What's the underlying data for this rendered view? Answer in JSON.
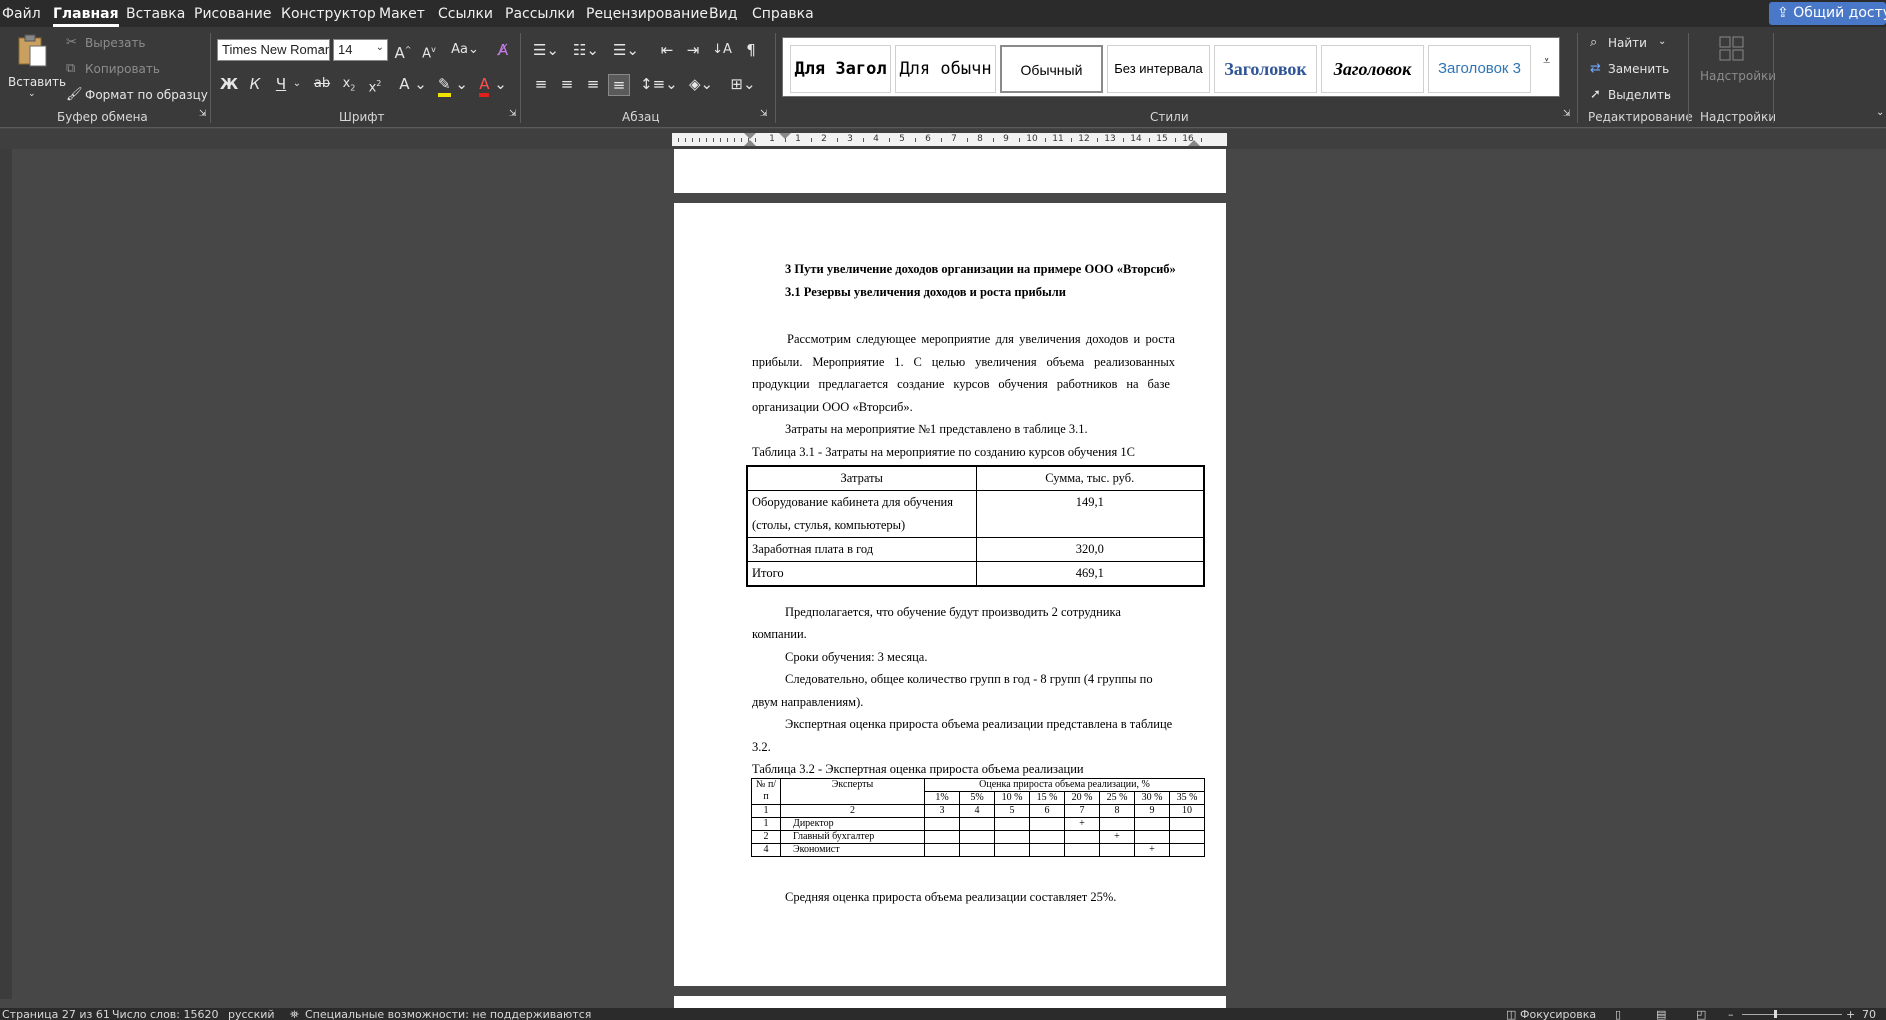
{
  "menu": {
    "items": [
      "Файл",
      "Главная",
      "Вставка",
      "Рисование",
      "Конструктор",
      "Макет",
      "Ссылки",
      "Рассылки",
      "Рецензирование",
      "Вид",
      "Справка"
    ],
    "active_index": 1,
    "share_label": "Общий доступ"
  },
  "ribbon": {
    "clipboard": {
      "paste_label": "Вставить",
      "cut_label": "Вырезать",
      "copy_label": "Копировать",
      "format_painter_label": "Формат по образцу",
      "group_label": "Буфер обмена"
    },
    "font": {
      "font_name": "Times New Roman",
      "font_size": "14",
      "group_label": "Шрифт",
      "bold_glyph": "Ж",
      "italic_glyph": "К",
      "underline_glyph": "Ч"
    },
    "paragraph": {
      "group_label": "Абзац"
    },
    "styles": {
      "group_label": "Стили",
      "items": [
        "Для Загол",
        "Для обычн",
        "Обычный",
        "Без интервала",
        "Заголовок",
        "Заголовок",
        "Заголовок 3"
      ]
    },
    "editing": {
      "find_label": "Найти",
      "replace_label": "Заменить",
      "select_label": "Выделить",
      "group_label": "Редактирование"
    },
    "addins": {
      "button_label": "Надстройки",
      "group_label": "Надстройки"
    }
  },
  "ruler": {
    "numbers": [
      "1",
      "1",
      "2",
      "3",
      "4",
      "5",
      "6",
      "7",
      "8",
      "9",
      "10",
      "11",
      "12",
      "13",
      "14",
      "15",
      "16"
    ]
  },
  "document": {
    "heading1": "3 Пути увеличение доходов организации на примере ООО «Вторсиб»",
    "heading2": "3.1 Резервы увеличения доходов и роста прибыли",
    "para1": [
      "Рассмотрим следующее мероприятие для увеличения доходов и роста",
      "прибыли. Мероприятие 1. С целью увеличения объема реализованных",
      "продукции предлагается создание курсов обучения  работников на базе",
      "организации ООО «Вторсиб»."
    ],
    "para2": "Затраты на мероприятие №1 представлено в таблице 3.1.",
    "table1_caption": "Таблица 3.1 - Затраты на мероприятие по созданию курсов обучения 1С",
    "table1": {
      "headers": [
        "Затраты",
        "Сумма, тыс. руб."
      ],
      "rows": [
        {
          "name_line1": "Оборудование кабинета для обучения",
          "name_line2": "(столы, стулья, компьютеры)",
          "value": "149,1"
        },
        {
          "name_line1": "Заработная плата в год",
          "value": "320,0"
        },
        {
          "name_line1": "Итого",
          "value": "469,1"
        }
      ]
    },
    "para3": [
      "Предполагается, что обучение будут производить 2 сотрудника",
      "компании."
    ],
    "para4": "Сроки обучения: 3  месяца.",
    "para5": [
      "Следовательно, общее количество групп в год - 8 групп (4 группы по",
      "двум направлениям)."
    ],
    "para6": [
      "Экспертная оценка прироста объема реализации представлена в таблице",
      "3.2."
    ],
    "table2_caption": "Таблица 3.2 - Экспертная оценка прироста объема реализации",
    "table2": {
      "header_num": "№ п/п",
      "header_experts": "Эксперты",
      "header_rating": "Оценка прироста объема реализации, %",
      "percents": [
        "1%",
        "5%",
        "10 %",
        "15 %",
        "20 %",
        "25 %",
        "30 %",
        "35 %"
      ],
      "col_numbers": [
        "1",
        "2",
        "3",
        "4",
        "5",
        "6",
        "7",
        "8",
        "9",
        "10"
      ],
      "rows": [
        {
          "n": "1",
          "name": "Директор",
          "marks": [
            "",
            "",
            "",
            "",
            "+",
            "",
            "",
            ""
          ]
        },
        {
          "n": "2",
          "name": "Главный бухгалтер",
          "marks": [
            "",
            "",
            "",
            "",
            "",
            "+",
            "",
            ""
          ]
        },
        {
          "n": "4",
          "name": "Экономист",
          "marks": [
            "",
            "",
            "",
            "",
            "",
            "",
            "+",
            ""
          ]
        }
      ]
    },
    "para7": "Средняя оценка прироста объема реализации составляет 25%."
  },
  "status": {
    "page": "Страница 27 из 61",
    "words": "Число слов: 15620",
    "language": "русский",
    "accessibility": "Специальные возможности: не поддерживаются",
    "focus": "Фокусировка",
    "zoom": "70"
  }
}
